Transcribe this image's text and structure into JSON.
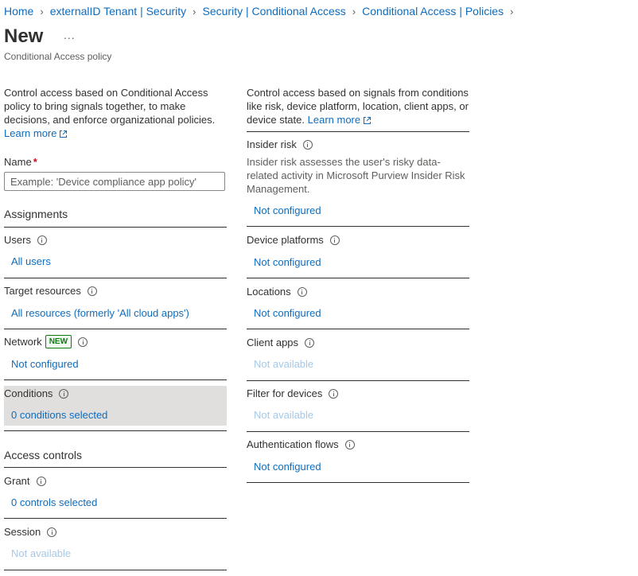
{
  "breadcrumb": [
    "Home",
    "externalID Tenant | Security",
    "Security | Conditional Access",
    "Conditional Access | Policies"
  ],
  "title": "New",
  "more_label": "...",
  "subtitle": "Conditional Access policy",
  "left_description": "Control access based on Conditional Access policy to bring signals together, to make decisions, and enforce organizational policies.",
  "right_description": "Control access based on signals from conditions like risk, device platform, location, client apps, or device state.",
  "learn_more": "Learn more",
  "name_field": {
    "label": "Name",
    "required_marker": "*",
    "placeholder": "Example: 'Device compliance app policy'",
    "value": ""
  },
  "assignments": {
    "heading": "Assignments",
    "users": {
      "label": "Users",
      "value": "All users"
    },
    "target_resources": {
      "label": "Target resources",
      "value": "All resources (formerly 'All cloud apps')"
    },
    "network": {
      "label": "Network",
      "badge": "NEW",
      "value": "Not configured"
    },
    "conditions": {
      "label": "Conditions",
      "value": "0 conditions selected"
    }
  },
  "access_controls": {
    "heading": "Access controls",
    "grant": {
      "label": "Grant",
      "value": "0 controls selected"
    },
    "session": {
      "label": "Session",
      "value": "Not available"
    }
  },
  "conditions_panel": {
    "insider_risk": {
      "label": "Insider risk",
      "description": "Insider risk assesses the user's risky data-related activity in Microsoft Purview Insider Risk Management.",
      "value": "Not configured"
    },
    "device_platforms": {
      "label": "Device platforms",
      "value": "Not configured"
    },
    "locations": {
      "label": "Locations",
      "value": "Not configured"
    },
    "client_apps": {
      "label": "Client apps",
      "value": "Not available"
    },
    "filter_for_devices": {
      "label": "Filter for devices",
      "value": "Not available"
    },
    "authentication_flows": {
      "label": "Authentication flows",
      "value": "Not configured"
    }
  },
  "icons": {
    "info": "info-icon",
    "external_link": "external-link-icon",
    "chevron": "chevron-right-icon"
  },
  "colors": {
    "link": "#0f6cbd",
    "disabled_link": "#a6c8e6",
    "selected_row": "#e1dfdd",
    "badge": "#107c10",
    "required": "#c50f1f"
  }
}
